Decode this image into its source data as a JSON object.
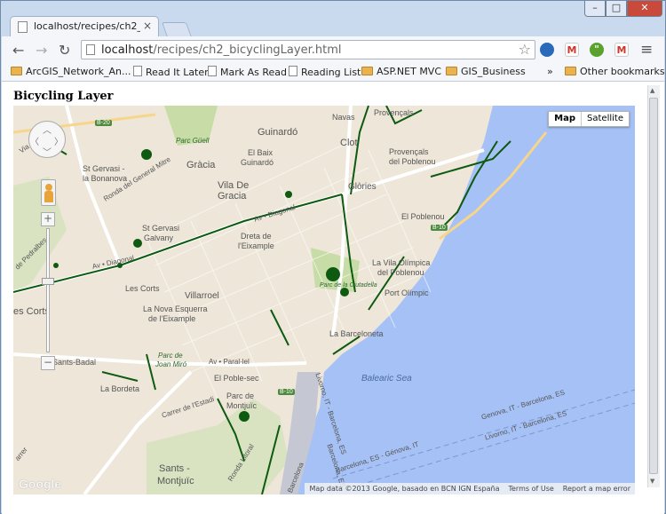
{
  "browser": {
    "tab_title": "localhost/recipes/ch2_bic",
    "tab_close": "×",
    "window_min": "–",
    "window_max": "□",
    "window_close": "✕",
    "back": "←",
    "forward": "→",
    "reload": "↻",
    "url_host": "localhost",
    "url_path": "/recipes/ch2_bicyclingLayer.html",
    "star": "☆",
    "menu": "≡",
    "bookmarks_overflow": "»"
  },
  "bookmarks": [
    {
      "label": "ArcGIS_Network_An...",
      "icon": "folder"
    },
    {
      "label": "Read It Later",
      "icon": "page"
    },
    {
      "label": "Mark As Read",
      "icon": "page"
    },
    {
      "label": "Reading List",
      "icon": "page"
    },
    {
      "label": "ASP.NET MVC",
      "icon": "folder"
    },
    {
      "label": "GIS_Business",
      "icon": "folder"
    },
    {
      "label": "Other bookmarks",
      "icon": "folder"
    }
  ],
  "page": {
    "title": "Bicycling Layer"
  },
  "map": {
    "map_type_map": "Map",
    "map_type_satellite": "Satellite",
    "zoom_in": "+",
    "zoom_out": "−",
    "pan_up": "︿",
    "pan_down": "﹀",
    "pan_left": "〈",
    "pan_right": "〉",
    "logo": "Google",
    "footer_data": "Map data ©2013 Google, basado en BCN IGN España",
    "footer_terms": "Terms of Use",
    "footer_report": "Report a map error",
    "colors": {
      "land": "#ede6d9",
      "water": "#a5c1f5",
      "park": "#c7dca6",
      "bike": "#0d5a10",
      "road": "#ffffff"
    },
    "labels": {
      "navas": "Navas",
      "provencals": "Provençals",
      "guinardo": "Guinardó",
      "parc_guell": "Parc Güell",
      "clot": "Clot",
      "provencals2": "Provençals",
      "del_poblenou": "del Poblenou",
      "el_baix": "El Baix",
      "guinardo2": "Guinardó",
      "gracia": "Gràcia",
      "st_gervasi": "St Gervasi -",
      "la_bonanova": "la Bonanova",
      "vila_de": "Vila De",
      "gracia2": "Gracia",
      "glories": "Glòries",
      "ronda_gm": "Ronda del General Mitre",
      "el_poblenou": "El Poblenou",
      "st_gervasi2": "St Gervasi",
      "galvany": "Galvany",
      "dreta": "Dreta de",
      "leixample": "l'Eixample",
      "av_diagonal": "Av • Diagonal",
      "av_diagonal2": "Av • Diagonal",
      "la_vila": "La Vila Olímpica",
      "del_poblenou2": "del Poblenou",
      "les_corts": "Les Corts",
      "parc_ciutadella": "Parc de la Ciutadella",
      "villarroel": "Villarroel",
      "port_olimpic": "Port Olímpic",
      "les_corts2": "es Corts",
      "la_nova": "La Nova Esquerra",
      "de_leixample": "de l'Eixample",
      "la_barceloneta": "La Barceloneta",
      "sants_badal": "Sants-Badal",
      "parc_joan": "Parc de",
      "joan_miro": "Joan Miró",
      "av_parallel": "Av • Paral·lel",
      "balearic": "Balearic Sea",
      "el_poble_sec": "El Poble-sec",
      "la_bordeta": "La Bordeta",
      "parc_de": "Parc de",
      "montjuic_l": "Montjuïc",
      "carrer_estadi": "Carrer de l'Estadi",
      "livorno": "Livorno, IT - Barcelona, ES",
      "genova": "Genova, IT - Barcelona, ES",
      "livorno2": "Livorno, IT - Barcelona, ES",
      "barcelona_genova": "Barcelona, ES - Génova, IT",
      "sants": "Sants -",
      "montjuic": "Montjuïc",
      "ronda_litoral": "Ronda Litoral",
      "barcelona_road": "Barcelona",
      "b20": "B-20",
      "b10": "B-10",
      "b10b": "B-10",
      "via_a": "Via A",
      "de_pedralbes": "de Pedralbes",
      "carrer": "arrer",
      "barcelona_es": "Barcelona, ES"
    }
  }
}
